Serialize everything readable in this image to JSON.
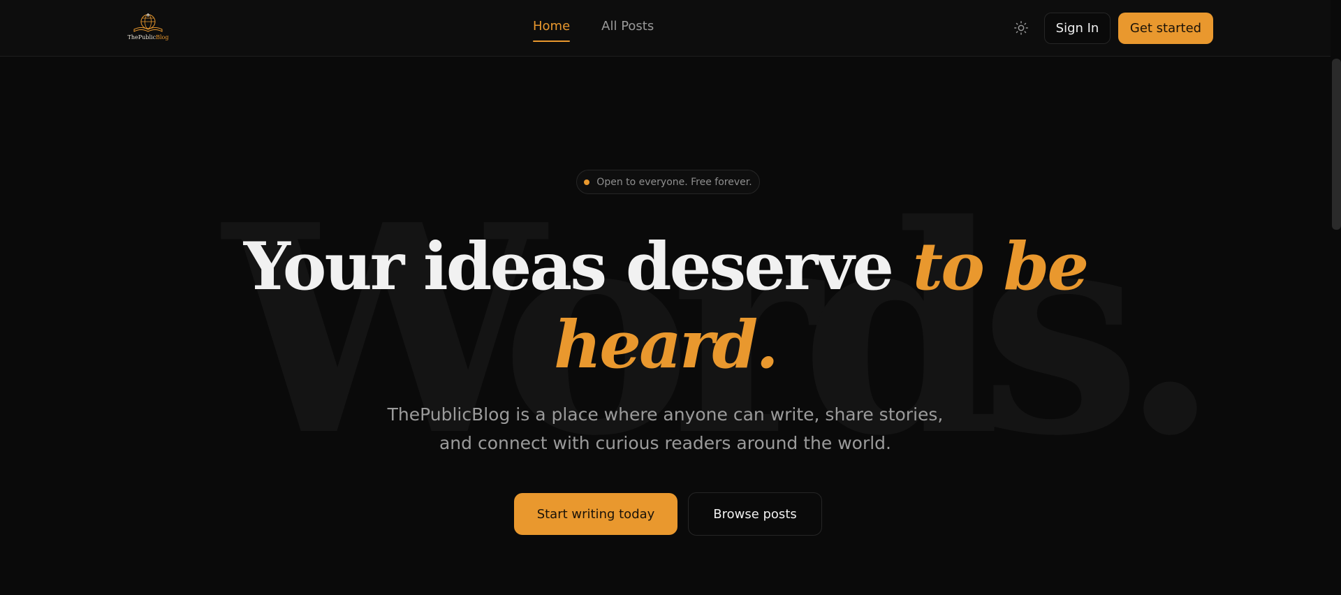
{
  "brand": {
    "name_part1": "The",
    "name_part2": "Public",
    "name_part3": "Blog",
    "logo_icon": "globe-book-logo"
  },
  "nav": {
    "links": [
      {
        "label": "Home",
        "active": true
      },
      {
        "label": "All Posts",
        "active": false
      }
    ],
    "theme_icon": "sun-icon",
    "signin_label": "Sign In",
    "getstarted_label": "Get started"
  },
  "hero": {
    "badge": "Open to everyone. Free forever.",
    "background_word": "Words.",
    "headline_plain": "Your ideas deserve ",
    "headline_accent_1": "to be",
    "headline_accent_2": "heard.",
    "subtitle_line1": "ThePublicBlog is a place where anyone can write, share stories,",
    "subtitle_line2": "and connect with curious readers around the world.",
    "cta_primary": "Start writing today",
    "cta_secondary": "Browse posts"
  },
  "colors": {
    "background": "#0a0a0a",
    "accent": "#e9982e",
    "text": "#f1f1f1",
    "muted": "#9b9b9b"
  }
}
